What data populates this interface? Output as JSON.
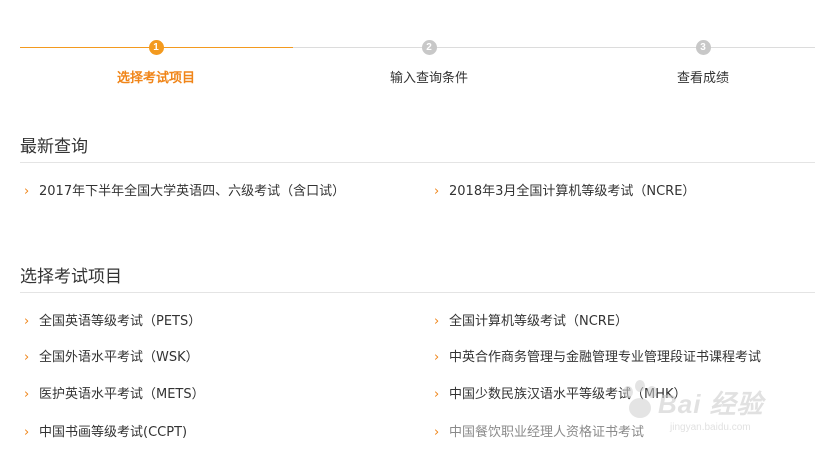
{
  "stepper": {
    "steps": [
      {
        "number": "1",
        "label": "选择考试项目"
      },
      {
        "number": "2",
        "label": "输入查询条件"
      },
      {
        "number": "3",
        "label": "查看成绩"
      }
    ]
  },
  "recent": {
    "title": "最新查询",
    "items": [
      "2017年下半年全国大学英语四、六级考试（含口试）",
      "2018年3月全国计算机等级考试（NCRE）"
    ]
  },
  "select": {
    "title": "选择考试项目",
    "items": [
      "全国英语等级考试（PETS）",
      "全国计算机等级考试（NCRE）",
      "全国外语水平考试（WSK）",
      "中英合作商务管理与金融管理专业管理段证书课程考试",
      "医护英语水平考试（METS）",
      "中国少数民族汉语水平等级考试（MHK）",
      "中国书画等级考试(CCPT)",
      "中国餐饮职业经理人资格证书考试"
    ]
  },
  "watermark": {
    "text": "Bai 经验",
    "sub": "jingyan.baidu.com"
  },
  "colors": {
    "accent": "#f39a1f",
    "accent_text": "#f08519",
    "inactive_step": "#c8c8c8"
  }
}
